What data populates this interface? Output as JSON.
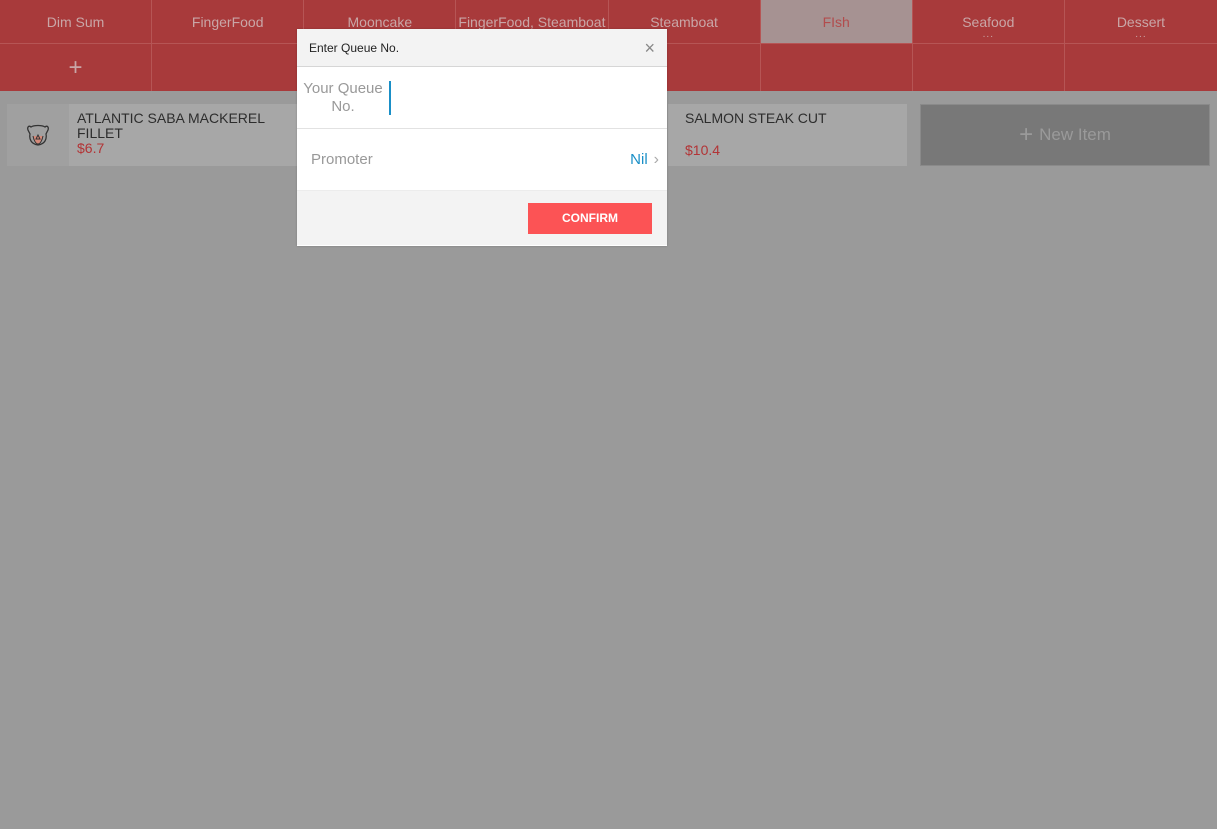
{
  "categories": [
    {
      "label": "Dim Sum",
      "active": false,
      "more": ""
    },
    {
      "label": "FingerFood",
      "active": false,
      "more": ""
    },
    {
      "label": "Mooncake",
      "active": false,
      "more": ""
    },
    {
      "label": "FingerFood, Steamboat",
      "active": false,
      "more": ""
    },
    {
      "label": "Steamboat",
      "active": false,
      "more": ""
    },
    {
      "label": "FIsh",
      "active": true,
      "more": ""
    },
    {
      "label": "Seafood",
      "active": false,
      "more": "..."
    },
    {
      "label": "Dessert",
      "active": false,
      "more": "..."
    }
  ],
  "subrow": {
    "add_icon": "+"
  },
  "items": [
    {
      "name": "ATLANTIC SABA MACKEREL FILLET",
      "price": "$6.7",
      "icon": "fish-fillet-icon"
    },
    {
      "name": "SALMON STEAK CUT",
      "price": "$10.4"
    }
  ],
  "new_item": {
    "icon": "+",
    "label": "New Item"
  },
  "modal": {
    "title": "Enter Queue No.",
    "close_icon": "×",
    "queue_label": "Your Queue No.",
    "queue_value": "",
    "promoter_label": "Promoter",
    "promoter_value": "Nil",
    "chevron": "›",
    "confirm_label": "CONFIRM"
  },
  "colors": {
    "header_bg": "#a83a3b",
    "active_tab_bg": "#a69292",
    "price": "#b23436",
    "confirm": "#fc5355",
    "accent_blue": "#1a8fc7"
  }
}
